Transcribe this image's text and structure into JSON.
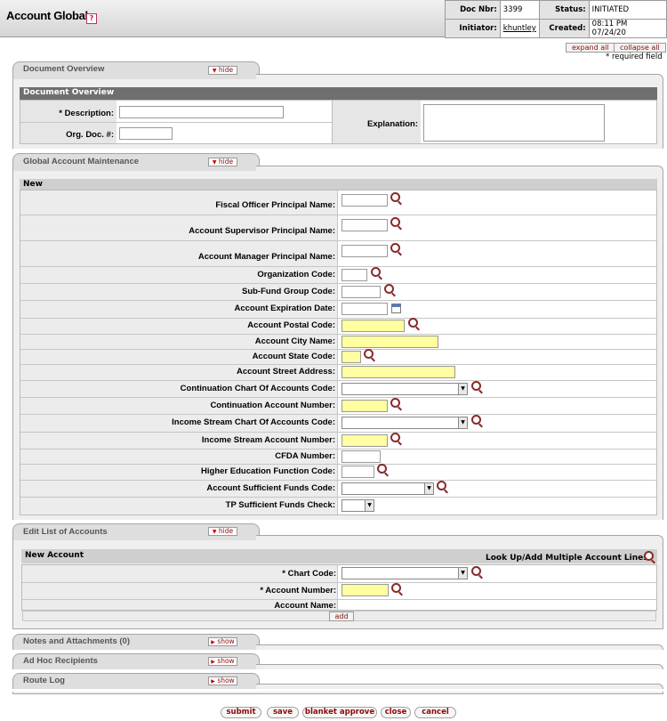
{
  "header": {
    "title": "Account Global",
    "help": "?",
    "doc_nbr_label": "Doc Nbr:",
    "doc_nbr": "3399",
    "status_label": "Status:",
    "status": "INITIATED",
    "initiator_label": "Initiator:",
    "initiator": "khuntley",
    "created_label": "Created:",
    "created": "08:11 PM 07/24/20"
  },
  "top_buttons": {
    "expand_all": "expand all",
    "collapse_all": "collapse all",
    "required_note": "* required field"
  },
  "document_overview": {
    "tab_label": "Document Overview",
    "toggle": "hide",
    "section_header": "Document Overview",
    "description_label": "* Description:",
    "description_value": "",
    "org_doc_label": "Org. Doc. #:",
    "org_doc_value": "",
    "explanation_label": "Explanation:",
    "explanation_value": ""
  },
  "global_maintenance": {
    "tab_label": "Global Account Maintenance",
    "toggle": "hide",
    "section_header": "New",
    "fields": [
      "Fiscal Officer Principal Name:",
      "Account Supervisor Principal Name:",
      "Account Manager Principal Name:",
      "Organization Code:",
      "Sub-Fund Group Code:",
      "Account Expiration Date:",
      "Account Postal Code:",
      "Account City Name:",
      "Account State Code:",
      "Account Street Address:",
      "Continuation Chart Of Accounts Code:",
      "Continuation Account Number:",
      "Income Stream Chart Of Accounts Code:",
      "Income Stream Account Number:",
      "CFDA Number:",
      "Higher Education Function Code:",
      "Account Sufficient Funds Code:",
      "TP Sufficient Funds Check:"
    ]
  },
  "edit_list": {
    "tab_label": "Edit List of Accounts",
    "toggle": "hide",
    "section_header": "New Account",
    "lookup_multiple": "Look Up/Add Multiple Account Lines",
    "chart_code_label": "* Chart Code:",
    "account_number_label": "* Account Number:",
    "account_name_label": "Account Name:",
    "add_button": "add"
  },
  "collapsed_tabs": [
    {
      "label": "Notes and Attachments (0)",
      "toggle": "show"
    },
    {
      "label": "Ad Hoc Recipients",
      "toggle": "show"
    },
    {
      "label": "Route Log",
      "toggle": "show"
    }
  ],
  "bottom_buttons": [
    "submit",
    "save",
    "blanket approve",
    "close",
    "cancel"
  ],
  "colors": {
    "required_field": "#fffea0",
    "section_dark": "#6f6f6f",
    "button_text": "#8a0a0a"
  },
  "icons": [
    "help-icon",
    "lookup-icon",
    "calendar-icon",
    "dropdown-arrow-icon"
  ]
}
